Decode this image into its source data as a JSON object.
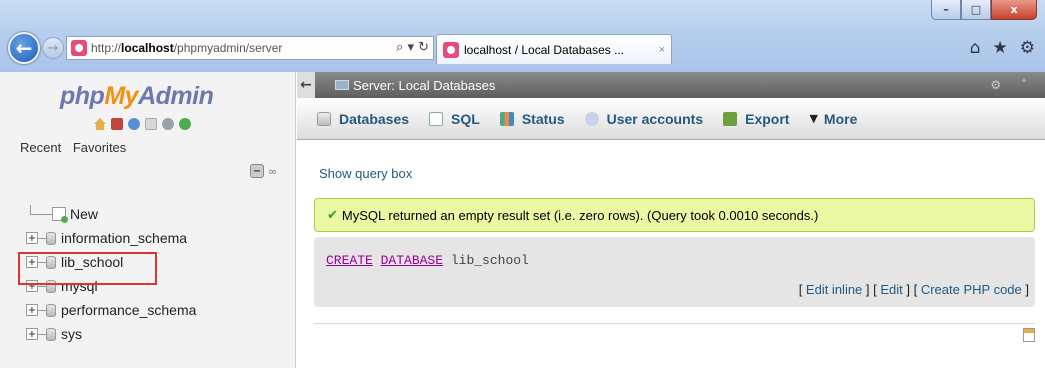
{
  "browser": {
    "address_prefix": "http://",
    "address_host": "localhost",
    "address_path": "/phpmyadmin/server",
    "address_icons": "⌕ ▾ ↻",
    "tab_title": "localhost / Local Databases ...",
    "tab_close": "×",
    "window_controls": {
      "minimize": "–",
      "maximize": "□",
      "close": "x"
    },
    "back": "←",
    "forward": "→",
    "tools": [
      "⌂",
      "★",
      "⚙"
    ]
  },
  "nav": {
    "logo": {
      "php": "php",
      "my": "My",
      "admin": "Admin"
    },
    "recent": "Recent",
    "favorites": "Favorites",
    "collapse": "−",
    "link": "∞",
    "items": [
      {
        "label": "New",
        "type": "new"
      },
      {
        "label": "information_schema",
        "type": "db"
      },
      {
        "label": "lib_school",
        "type": "db"
      },
      {
        "label": "mysql",
        "type": "db"
      },
      {
        "label": "performance_schema",
        "type": "db"
      },
      {
        "label": "sys",
        "type": "db"
      }
    ],
    "expander": "+"
  },
  "main": {
    "breadcrumb": "Server: Local Databases",
    "collapse_arrow": "←",
    "right_icons": "⚙ ˄",
    "tabs": [
      {
        "label": "Databases",
        "icon": "db"
      },
      {
        "label": "SQL",
        "icon": "sql"
      },
      {
        "label": "Status",
        "icon": "status"
      },
      {
        "label": "User accounts",
        "icon": "users"
      },
      {
        "label": "Export",
        "icon": "export"
      }
    ],
    "more": "More",
    "more_caret": "▼",
    "show_query": "Show query box",
    "success_check": "✔",
    "success_msg": "MySQL returned an empty result set (i.e. zero rows). (Query took 0.0010 seconds.)",
    "sql": {
      "kw1": "CREATE",
      "kw2": "DATABASE",
      "rest": " lib_school"
    },
    "links": {
      "edit_inline": "Edit inline",
      "edit": "Edit",
      "create_php": "Create PHP code"
    }
  }
}
